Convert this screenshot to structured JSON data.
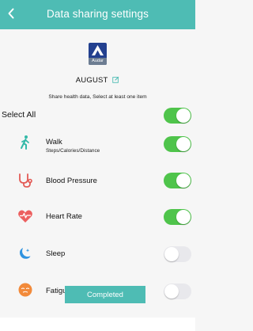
{
  "header": {
    "title": "Data sharing settings"
  },
  "device": {
    "logo_text": "Audar",
    "name": "AUGUST"
  },
  "instructions": "Share health data, Select at least one item",
  "select_all": {
    "label": "Select All",
    "enabled": true
  },
  "items": [
    {
      "label": "Walk",
      "sublabel": "Steps/Calories/Distance",
      "icon": "walk-icon",
      "icon_color": "#33b9a8",
      "enabled": true
    },
    {
      "label": "Blood Pressure",
      "icon": "stethoscope-icon",
      "icon_color": "#e35b56",
      "enabled": true
    },
    {
      "label": "Heart Rate",
      "icon": "heart-rate-icon",
      "icon_color": "#ec5f5f",
      "enabled": true
    },
    {
      "label": "Sleep",
      "icon": "moon-icon",
      "icon_color": "#2f93e0",
      "enabled": false
    },
    {
      "label": "Fatigue",
      "icon": "tired-face-icon",
      "icon_color": "#f28a3a",
      "enabled": false
    }
  ],
  "footer": {
    "button_label": "Completed"
  },
  "colors": {
    "accent": "#4ebcb4",
    "toggle_on": "#4fc44b",
    "toggle_off": "#e8e8ec"
  }
}
